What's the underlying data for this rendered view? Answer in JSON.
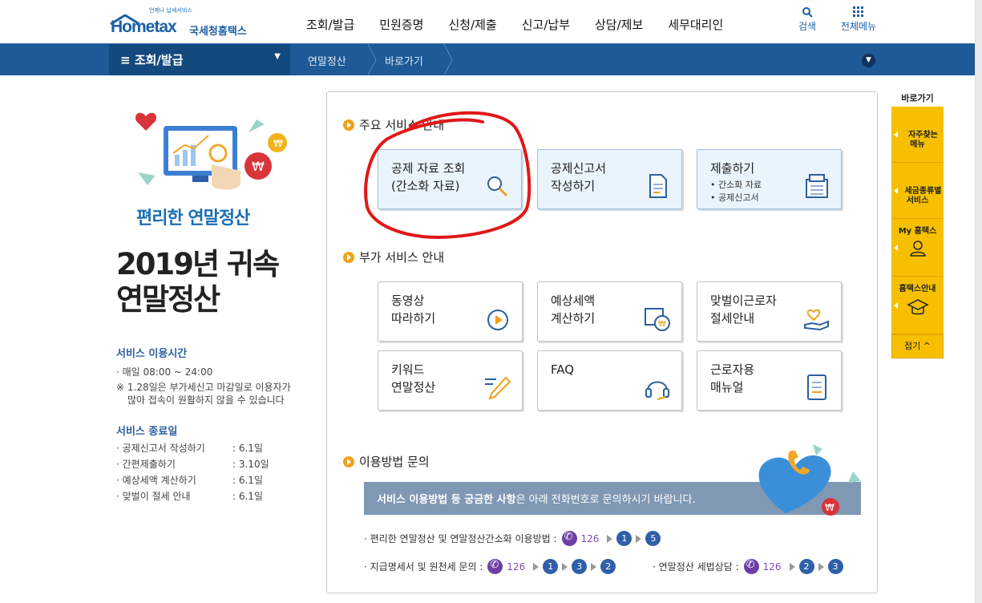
{
  "header": {
    "logo_sub": "언제나 납세서비스",
    "logo_brand": "Hometax",
    "logo_kor": "국세청홈택스",
    "nav": [
      "조회/발급",
      "민원증명",
      "신청/제출",
      "신고/납부",
      "상담/제보",
      "세무대리인"
    ],
    "search_label": "검색",
    "allmenu_label": "전체메뉴"
  },
  "navbar": {
    "main": "조회/발급",
    "crumb1": "연말정산",
    "crumb2": "바로가기"
  },
  "left": {
    "promo": "편리한 연말정산",
    "year_line1": "2019년 귀속",
    "year_line2": "연말정산",
    "hours_title": "서비스 이용시간",
    "hours_daily": "· 매일 08:00 ~ 24:00",
    "hours_note1": "※ 1.28일은 부가세신고 마감일로 이용자가",
    "hours_note2": "많아 접속이 원활하지 않을 수 있습니다",
    "end_title": "서비스 종료일",
    "end_items": [
      {
        "label": "· 공제신고서 작성하기",
        "date": ": 6.1일"
      },
      {
        "label": "· 간편제출하기",
        "date": ": 3.10일"
      },
      {
        "label": "· 예상세액 계산하기",
        "date": ": 6.1일"
      },
      {
        "label": "· 맞벌이 절세 안내",
        "date": ": 6.1일"
      }
    ]
  },
  "main": {
    "section1_title": "주요 서비스 안내",
    "section2_title": "부가 서비스 안내",
    "section3_title": "이용방법 문의",
    "primary_cards": [
      {
        "title": "공제 자료 조회\n(간소화 자료)",
        "sub": "",
        "icon": "magnifier-icon"
      },
      {
        "title": "공제신고서\n작성하기",
        "sub": "",
        "icon": "document-icon"
      },
      {
        "title": "제출하기",
        "sub": "• 간소화 자료\n• 공제신고서",
        "icon": "printer-icon"
      }
    ],
    "secondary_cards": [
      {
        "title": "동영상\n따라하기",
        "icon": "play-icon"
      },
      {
        "title": "예상세액\n계산하기",
        "icon": "calculator-icon"
      },
      {
        "title": "맞벌이근로자\n절세안내",
        "icon": "hand-heart-icon"
      },
      {
        "title": "키워드\n연말정산",
        "icon": "pencil-icon"
      },
      {
        "title": "FAQ",
        "icon": "headset-icon"
      },
      {
        "title": "근로자용\n매뉴얼",
        "icon": "manual-icon"
      }
    ],
    "banner_bold": "서비스 이용방법 등 궁금한 사항",
    "banner_rest": "은 아래 전화번호로 문의하시기 바랍니다.",
    "contact1_label": "· 편리한 연말정산 및 연말정산간소화 이용방법 :",
    "contact2_label": "· 지급명세서  및 원천세 문의 :",
    "contact3_label": "· 연말정산 세법상담  :",
    "phone": "126",
    "contact1_steps": [
      "1",
      "5"
    ],
    "contact2_steps": [
      "1",
      "3",
      "2"
    ],
    "contact3_steps": [
      "2",
      "3"
    ]
  },
  "quick": {
    "title": "바로가기",
    "items": [
      {
        "label": "자주찾는\n메뉴",
        "icon": "star-icon"
      },
      {
        "label": "세금종류별\n서비스",
        "icon": "checkbox-icon"
      },
      {
        "label": "My 홈택스",
        "icon": "person-icon"
      },
      {
        "label": "홈택스안내",
        "icon": "info-hat-icon"
      }
    ],
    "close": "접기 ^"
  },
  "colors": {
    "brand": "#1b5fa5",
    "navbar": "#1d5a97",
    "accent_orange": "#f0a11a",
    "quick_yellow": "#f6c000",
    "annotation_red": "#e01818",
    "phone_purple": "#6c3fa4"
  }
}
